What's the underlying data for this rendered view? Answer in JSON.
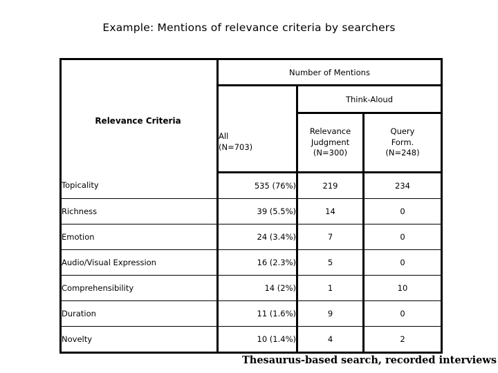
{
  "slide": {
    "title": "Example: Mentions of relevance criteria by searchers",
    "footer_note": "Thesaurus-based search, recorded interviews"
  },
  "table": {
    "group_header": "Number of Mentions",
    "think_aloud_header": "Think-Aloud",
    "columns": {
      "criteria": "Relevance Criteria",
      "all_label": "All",
      "all_n": "(N=703)",
      "relevance_judgment_label_1": "Relevance",
      "relevance_judgment_label_2": "Judgment",
      "relevance_judgment_n": "(N=300)",
      "query_form_label_1": "Query",
      "query_form_label_2": "Form.",
      "query_form_n": "(N=248)"
    },
    "rows": [
      {
        "criteria": "Topicality",
        "all": "535 (76%)",
        "relevance_judgment": "219",
        "query_form": "234"
      },
      {
        "criteria": "Richness",
        "all": "39 (5.5%)",
        "relevance_judgment": "14",
        "query_form": "0"
      },
      {
        "criteria": "Emotion",
        "all": "24 (3.4%)",
        "relevance_judgment": "7",
        "query_form": "0"
      },
      {
        "criteria": "Audio/Visual Expression",
        "all": "16 (2.3%)",
        "relevance_judgment": "5",
        "query_form": "0"
      },
      {
        "criteria": "Comprehensibility",
        "all": "14 (2%)",
        "relevance_judgment": "1",
        "query_form": "10"
      },
      {
        "criteria": "Duration",
        "all": "11 (1.6%)",
        "relevance_judgment": "9",
        "query_form": "0"
      },
      {
        "criteria": "Novelty",
        "all": "10 (1.4%)",
        "relevance_judgment": "4",
        "query_form": "2"
      }
    ]
  },
  "chart_data": {
    "type": "table",
    "title": "Example: Mentions of relevance criteria by searchers",
    "columns": [
      "Relevance Criteria",
      "All (N=703)",
      "Relevance Judgment (N=300)",
      "Query Form. (N=248)"
    ],
    "column_groups": [
      "",
      "Number of Mentions",
      "Think-Aloud",
      "Think-Aloud"
    ],
    "categories": [
      "Topicality",
      "Richness",
      "Emotion",
      "Audio/Visual Expression",
      "Comprehensibility",
      "Duration",
      "Novelty"
    ],
    "series": [
      {
        "name": "All (N=703)",
        "values": [
          535,
          39,
          24,
          16,
          14,
          11,
          10
        ],
        "percent": [
          "76%",
          "5.5%",
          "3.4%",
          "2.3%",
          "2%",
          "1.6%",
          "1.4%"
        ]
      },
      {
        "name": "Relevance Judgment (N=300)",
        "values": [
          219,
          14,
          7,
          5,
          1,
          9,
          4
        ]
      },
      {
        "name": "Query Form. (N=248)",
        "values": [
          234,
          0,
          0,
          0,
          10,
          0,
          2
        ]
      }
    ]
  }
}
